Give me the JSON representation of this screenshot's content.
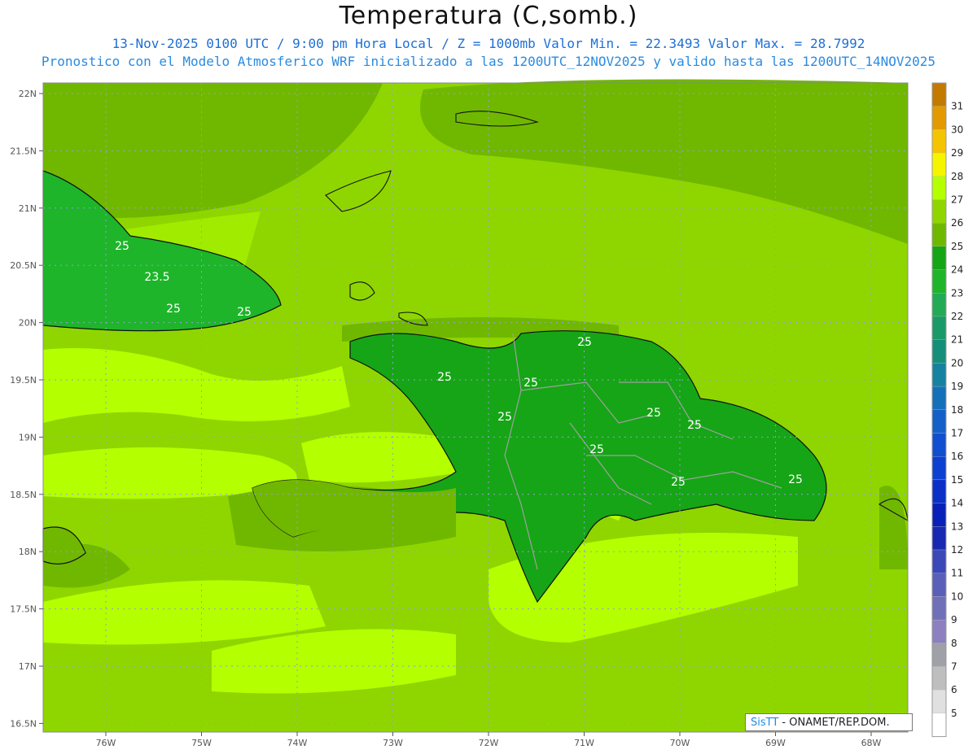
{
  "header": {
    "title": "Temperatura (C,somb.)",
    "line1": "13-Nov-2025 0100 UTC / 9:00 pm Hora Local / Z = 1000mb   Valor Min. = 22.3493  Valor Max. = 28.7992",
    "line2": "Pronostico con el Modelo Atmosferico WRF inicializado a las 1200UTC_12NOV2025 y valido hasta las  1200UTC_14NOV2025"
  },
  "axes": {
    "lat_labels": [
      "22N",
      "21.5N",
      "21N",
      "20.5N",
      "20N",
      "19.5N",
      "19N",
      "18.5N",
      "18N",
      "17.5N",
      "17N",
      "16.5N"
    ],
    "lon_labels": [
      "76W",
      "75W",
      "74W",
      "73W",
      "72W",
      "71W",
      "70W",
      "69W",
      "68W"
    ]
  },
  "contour_labels": [
    "25",
    "23.5",
    "25",
    "25",
    "25",
    "25",
    "25",
    "25",
    "25",
    "25",
    "25",
    "25",
    "25"
  ],
  "colorbar": {
    "labels": [
      "31",
      "30",
      "29",
      "28",
      "27",
      "26",
      "25",
      "24",
      "23",
      "22",
      "21",
      "20",
      "19",
      "18",
      "17",
      "16",
      "15",
      "14",
      "13",
      "12",
      "11",
      "10",
      "9",
      "8",
      "7",
      "6",
      "5"
    ],
    "colors": [
      "#c27a00",
      "#e29a00",
      "#f5c400",
      "#f5f500",
      "#b4ff00",
      "#8fd600",
      "#70b800",
      "#16a516",
      "#1eb52a",
      "#22aa55",
      "#1a9a66",
      "#168f7a",
      "#1582a0",
      "#1470b8",
      "#1460c8",
      "#1050d0",
      "#0c40d0",
      "#0a30c8",
      "#0820b8",
      "#1828b0",
      "#3a48b8",
      "#5a60b8",
      "#7070b8",
      "#8c80c0",
      "#a0a0a8",
      "#bebebe",
      "#e0e0e0",
      "#ffffff"
    ]
  },
  "credit": {
    "brand": "SisTT",
    "text": " - ONAMET/REP.DOM."
  }
}
